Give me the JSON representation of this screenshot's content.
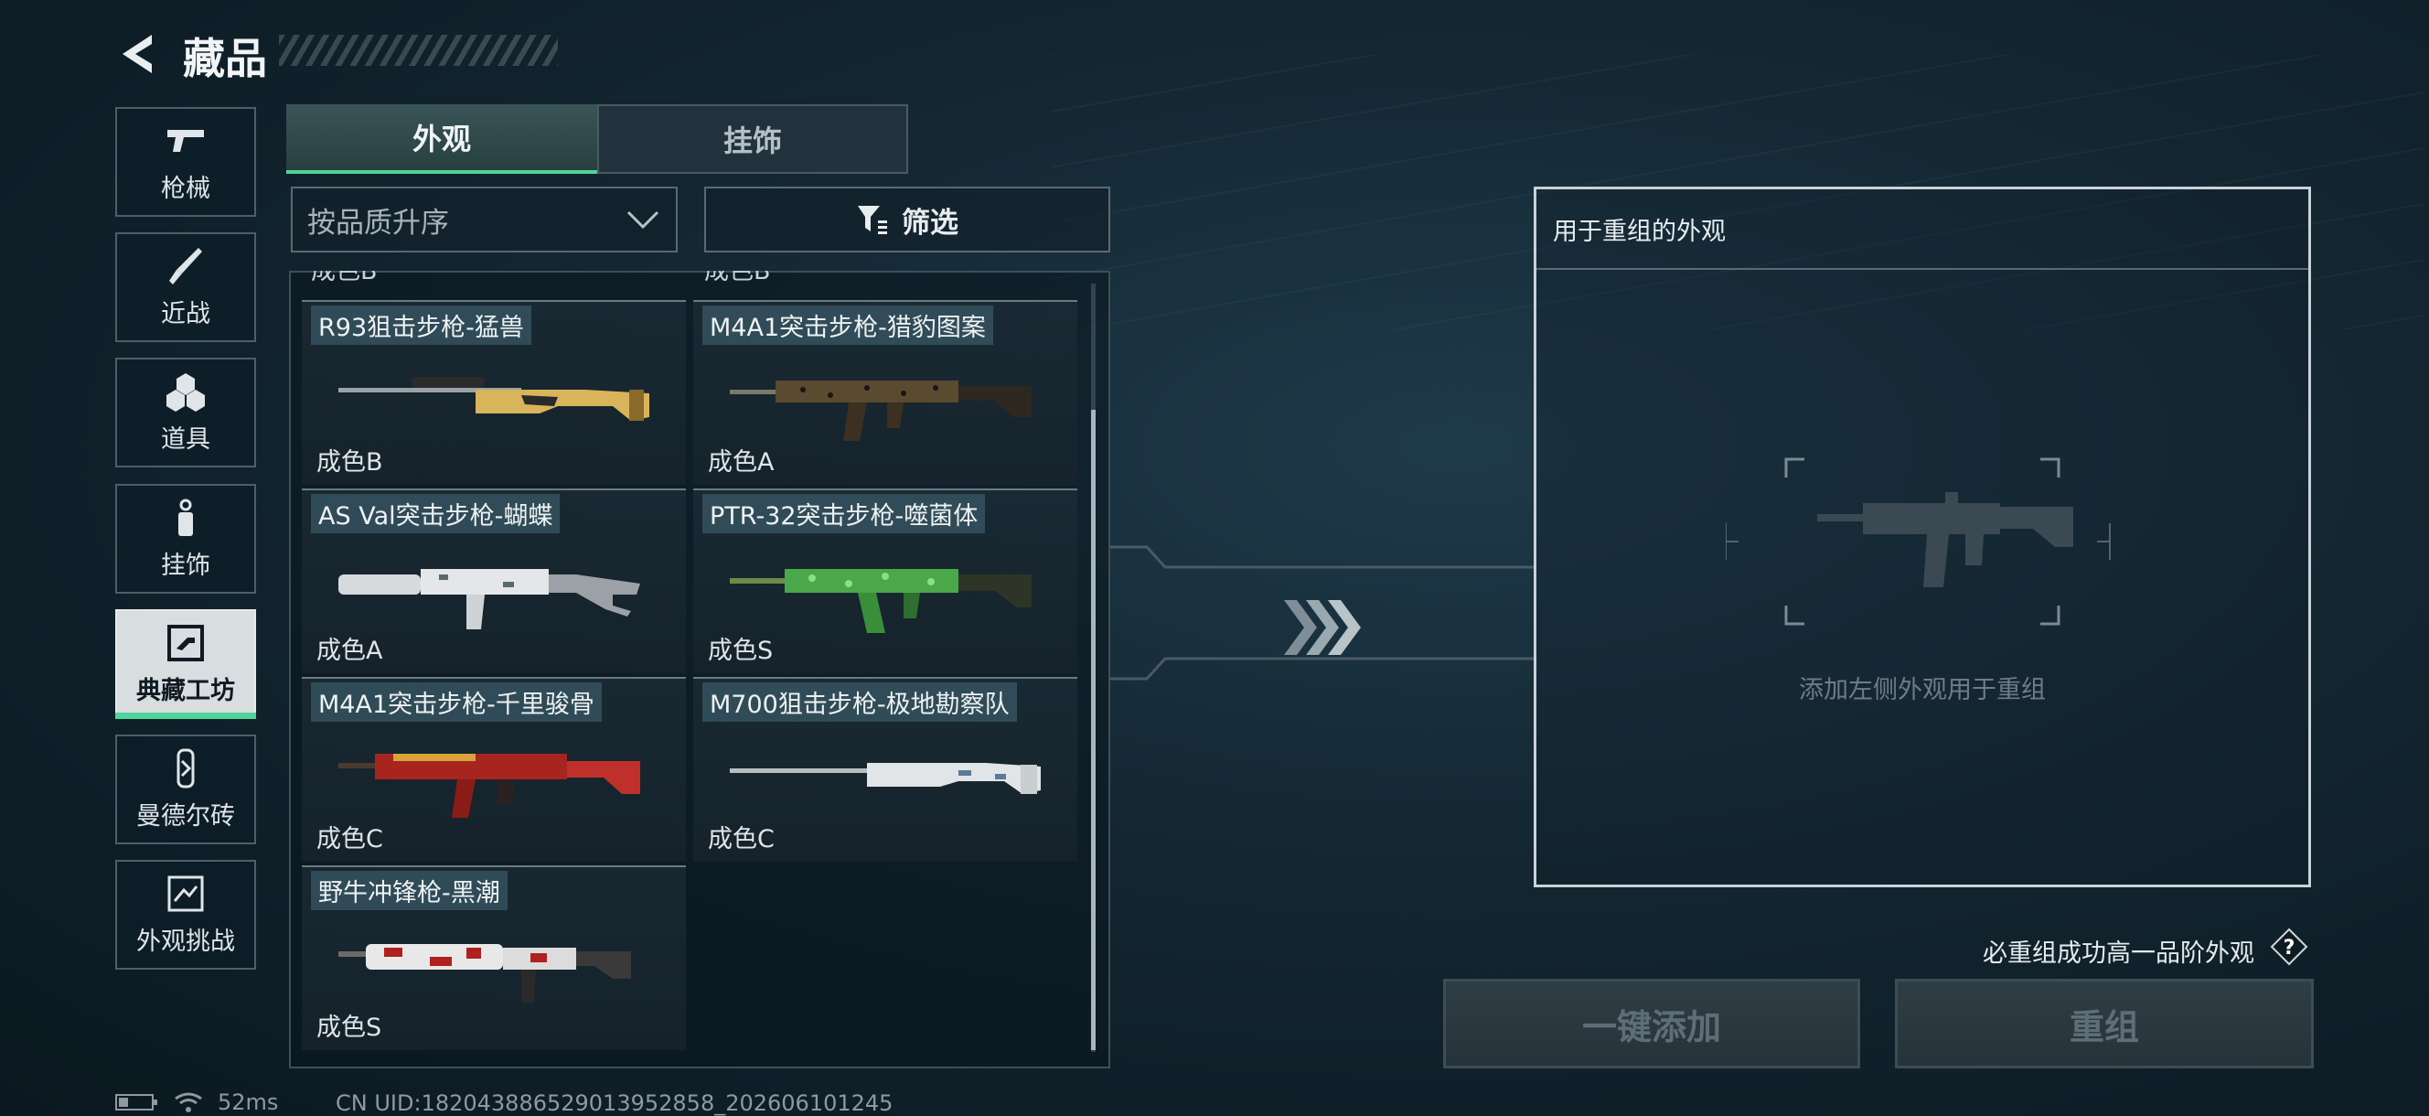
{
  "header": {
    "title": "藏品"
  },
  "nav": {
    "items": [
      {
        "label": "枪械",
        "icon": "pistol-icon"
      },
      {
        "label": "近战",
        "icon": "knife-icon"
      },
      {
        "label": "道具",
        "icon": "grenade-icon"
      },
      {
        "label": "挂饰",
        "icon": "charm-icon"
      },
      {
        "label": "典藏工坊",
        "icon": "workshop-icon",
        "active": true
      },
      {
        "label": "曼德尔砖",
        "icon": "brick-icon"
      },
      {
        "label": "外观挑战",
        "icon": "challenge-icon"
      }
    ]
  },
  "tabs": [
    {
      "label": "外观",
      "active": true
    },
    {
      "label": "挂饰",
      "active": false
    }
  ],
  "sort": {
    "value": "按品质升序"
  },
  "filter": {
    "label": "筛选"
  },
  "list": {
    "partial_grades": [
      "成色B",
      "成色B"
    ],
    "items": [
      {
        "name": "R93狙击步枪-猛兽",
        "grade": "成色B",
        "icon": "sniper-rifle-gold-icon"
      },
      {
        "name": "M4A1突击步枪-猎豹图案",
        "grade": "成色A",
        "icon": "assault-rifle-leopard-icon"
      },
      {
        "name": "AS Val突击步枪-蝴蝶",
        "grade": "成色A",
        "icon": "assault-rifle-white-icon"
      },
      {
        "name": "PTR-32突击步枪-噬菌体",
        "grade": "成色S",
        "icon": "assault-rifle-green-icon"
      },
      {
        "name": "M4A1突击步枪-千里骏骨",
        "grade": "成色C",
        "icon": "assault-rifle-red-icon"
      },
      {
        "name": "M700狙击步枪-极地勘察队",
        "grade": "成色C",
        "icon": "sniper-rifle-white-icon"
      },
      {
        "name": "野牛冲锋枪-黑潮",
        "grade": "成色S",
        "icon": "smg-camo-icon"
      }
    ]
  },
  "recombine": {
    "title": "用于重组的外观",
    "placeholder": "添加左侧外观用于重组",
    "guarantee": "必重组成功高一品阶外观",
    "auto_add_label": "一键添加",
    "recombine_label": "重组"
  },
  "status": {
    "ping": "52ms",
    "uid": "CN UID:1820438865290139528​58_202606101245"
  },
  "colors": {
    "accent": "#4fd49a",
    "background": "#132631"
  }
}
